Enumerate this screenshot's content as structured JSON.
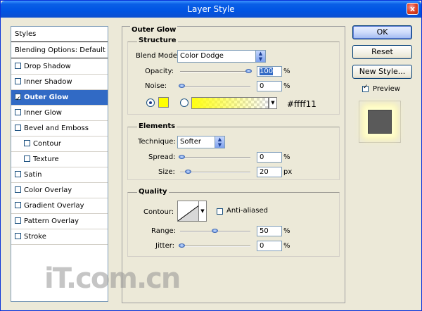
{
  "window": {
    "title": "Layer Style",
    "close_label": "x"
  },
  "styles_list": {
    "header": "Styles",
    "blending": "Blending Options: Default",
    "items": [
      {
        "label": "Drop Shadow",
        "checked": false,
        "sub": false,
        "active": false
      },
      {
        "label": "Inner Shadow",
        "checked": false,
        "sub": false,
        "active": false
      },
      {
        "label": "Outer Glow",
        "checked": true,
        "sub": false,
        "active": true
      },
      {
        "label": "Inner Glow",
        "checked": false,
        "sub": false,
        "active": false
      },
      {
        "label": "Bevel and Emboss",
        "checked": false,
        "sub": false,
        "active": false
      },
      {
        "label": "Contour",
        "checked": false,
        "sub": true,
        "active": false
      },
      {
        "label": "Texture",
        "checked": false,
        "sub": true,
        "active": false
      },
      {
        "label": "Satin",
        "checked": false,
        "sub": false,
        "active": false
      },
      {
        "label": "Color Overlay",
        "checked": false,
        "sub": false,
        "active": false
      },
      {
        "label": "Gradient Overlay",
        "checked": false,
        "sub": false,
        "active": false
      },
      {
        "label": "Pattern Overlay",
        "checked": false,
        "sub": false,
        "active": false
      },
      {
        "label": "Stroke",
        "checked": false,
        "sub": false,
        "active": false
      }
    ]
  },
  "outer_glow": {
    "title": "Outer Glow",
    "structure": {
      "title": "Structure",
      "blend_mode_label": "Blend Mode:",
      "blend_mode_value": "Color Dodge",
      "opacity_label": "Opacity:",
      "opacity_value": "100",
      "noise_label": "Noise:",
      "noise_value": "0",
      "percent": "%",
      "glow_color": "#ffff00",
      "gradient_hex": "#ffff11"
    },
    "elements": {
      "title": "Elements",
      "technique_label": "Technique:",
      "technique_value": "Softer",
      "spread_label": "Spread:",
      "spread_value": "0",
      "size_label": "Size:",
      "size_value": "20",
      "px": "px",
      "percent": "%"
    },
    "quality": {
      "title": "Quality",
      "contour_label": "Contour:",
      "anti_aliased_label": "Anti-aliased",
      "range_label": "Range:",
      "range_value": "50",
      "jitter_label": "Jitter:",
      "jitter_value": "0",
      "percent": "%"
    }
  },
  "buttons": {
    "ok": "OK",
    "reset": "Reset",
    "new_style": "New Style...",
    "preview_label": "Preview"
  },
  "watermark": "iT.com.cn"
}
